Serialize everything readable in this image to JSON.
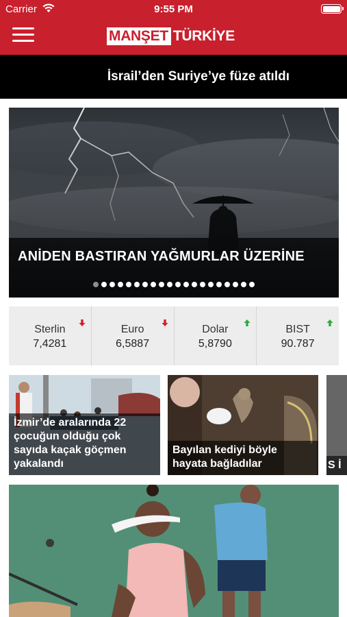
{
  "status_bar": {
    "carrier": "Carrier",
    "time": "9:55 PM"
  },
  "header": {
    "logo_part1": "MANŞET",
    "logo_part2": "TÜRKİYE",
    "menu_icon": "hamburger-menu-icon"
  },
  "ticker": {
    "headline": "İsrail’den Suriye’ye füze atıldı"
  },
  "hero": {
    "title": "ANİDEN BASTIRAN YAĞMURLAR ÜZERİNE",
    "slide_count": 20,
    "active_index": 0
  },
  "currencies": [
    {
      "name": "Sterlin",
      "value": "7,4281",
      "trend": "down"
    },
    {
      "name": "Euro",
      "value": "6,5887",
      "trend": "down"
    },
    {
      "name": "Dolar",
      "value": "5,8790",
      "trend": "up"
    },
    {
      "name": "BIST",
      "value": "90.787",
      "trend": "up"
    }
  ],
  "colors": {
    "brand_red": "#c8202d",
    "down": "#d0202a",
    "up": "#2faa3c"
  },
  "news_cards": [
    {
      "title": "İzmir’de aralarında 22 çocuğun olduğu çok sayıda kaçak göçmen yakalandı"
    },
    {
      "title": "Bayılan kediyi böyle hayata bağladılar"
    },
    {
      "title": "S İ"
    }
  ]
}
